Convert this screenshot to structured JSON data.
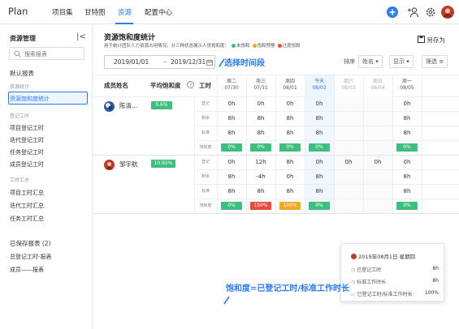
{
  "topnav": {
    "logo": "Plan",
    "items": [
      "项目集",
      "甘特图",
      "资源",
      "配置中心"
    ]
  },
  "sidebar": {
    "title": "资源管理",
    "search_placeholder": "搜索报表",
    "default_reports": "默认报表",
    "group_resource": "资源统计",
    "item_saturation": "资源饱和度统计",
    "group_logging": "登记工时",
    "logging_items": [
      "项目登记工时",
      "迭代登记工时",
      "任务登记工时",
      "成员登记工时"
    ],
    "group_summary": "工时汇总",
    "summary_items": [
      "项目工时汇总",
      "迭代工时汇总",
      "任务工时汇总"
    ],
    "saved_reports": "已保存报表 (2)",
    "saved_items": [
      "总登记工时-报表",
      "成员——报表"
    ]
  },
  "main": {
    "title": "资源饱和度统计",
    "description": "用于统计团队人力资源占用情况，分三种状态展示人员饱和度：",
    "legend": [
      {
        "label": "未饱和",
        "color": "#3fbf7f"
      },
      {
        "label": "饱和预警",
        "color": "#f5a623"
      },
      {
        "label": "过度饱和",
        "color": "#e74c3c"
      }
    ],
    "save_as": "另存为",
    "date_start": "2019/01/01",
    "date_sep": "~",
    "date_end": "2019/12/31",
    "annotation_date": "选择时间段",
    "sort_label": "排序",
    "sort_value": "姓名",
    "display_label": "显示",
    "filter_label": "筛选",
    "col_member": "成员姓名",
    "col_avg": "平均饱和度",
    "col_hours": "工时",
    "days": [
      {
        "weekday": "周二",
        "date": "07/30"
      },
      {
        "weekday": "周三",
        "date": "07/31"
      },
      {
        "weekday": "周四",
        "date": "08/01"
      },
      {
        "weekday": "今天",
        "date": "08/02"
      },
      {
        "weekday": "周六",
        "date": "08/03"
      },
      {
        "weekday": "周日",
        "date": "08/04"
      },
      {
        "weekday": "周一",
        "date": "08/05"
      }
    ],
    "row_labels": [
      "登记",
      "剩余",
      "标准",
      "饱和度"
    ],
    "members": [
      {
        "name": "陈清...",
        "avg": "5.6%",
        "logged": [
          "0h",
          "0h",
          "0h",
          "0h",
          "",
          "",
          "0h"
        ],
        "remaining": [
          "8h",
          "8h",
          "8h",
          "8h",
          "",
          "",
          "8h"
        ],
        "standard": [
          "8h",
          "8h",
          "8h",
          "8h",
          "",
          "",
          "8h"
        ],
        "saturation": [
          "0%",
          "0%",
          "0%",
          "0%",
          "",
          "",
          "0%"
        ]
      },
      {
        "name": "邹宇航",
        "avg": "10.92%",
        "logged": [
          "0h",
          "12h",
          "8h",
          "0h",
          "0h",
          "0h",
          "0h"
        ],
        "remaining": [
          "8h",
          "-4h",
          "0h",
          "8h",
          "",
          "",
          "8h"
        ],
        "standard": [
          "8h",
          "8h",
          "8h",
          "8h",
          "",
          "",
          "8h"
        ],
        "saturation": [
          "0%",
          "150%",
          "100%",
          "0%",
          "",
          "",
          "0%"
        ]
      }
    ]
  },
  "tooltip": {
    "date": "2019年08月1日 星期四",
    "logged_label": "已登记工时",
    "logged_value": "8h",
    "standard_label": "标准工作时长",
    "standard_value": "8h",
    "ratio_label": "已登记工时/标准工作时长",
    "ratio_value": "100%"
  },
  "annotation_saturation": "饱和度=已登记工时/标准工作时长",
  "colors": {
    "accent": "#2b7bf5",
    "green": "#3fbf7f",
    "orange": "#f5a623",
    "red": "#e74c3c"
  }
}
